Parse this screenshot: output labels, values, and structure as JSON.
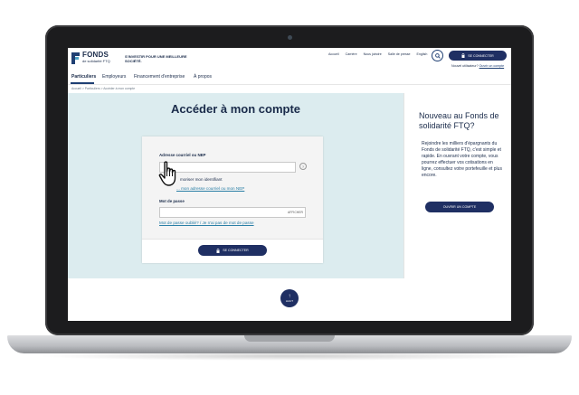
{
  "brand": {
    "name": "FONDS",
    "subtitle": "de solidarité FTQ",
    "tagline": "S'INVESTIR POUR UNE MEILLEURE SOCIÉTÉ."
  },
  "top_links": [
    "Accueil",
    "Carrière",
    "Nous joindre",
    "Salle de presse",
    "English"
  ],
  "header": {
    "login_label": "SE CONNECTER",
    "signup_question": "Nouvel utilisateur?",
    "signup_link": "Ouvrir un compte"
  },
  "nav": {
    "items": [
      "Particuliers",
      "Employeurs",
      "Financement d'entreprise",
      "À propos"
    ]
  },
  "breadcrumb": "Accueil  >  Particuliers  >  Accéder à mon compte",
  "page": {
    "title": "Accéder à mon compte"
  },
  "form": {
    "email_label": "Adresse courriel ou NEP",
    "email_value": "",
    "help_glyph": "?",
    "remember_label": "moriser mon identifiant",
    "forgot_email_link": "... mon adresse courriel ou mon NEP",
    "password_label": "Mot de passe",
    "password_value": "",
    "show_label": "AFFICHER",
    "forgot_password_link": "Mot de passe oublié? / Je n'ai pas de mot de passe",
    "submit_label": "SE CONNECTER"
  },
  "sidebar": {
    "title": "Nouveau au Fonds de solidarité FTQ?",
    "text": "Rejoindre les milliers d'épargnants du Fonds de solidarité FTQ, c'est simple et rapide. En ouvrant votre compte, vous pourrez effectuer vos cotisations en ligne, consultez votre portefeuille et plus encore.",
    "button_label": "OUVRIR UN COMPTE"
  },
  "back_to_top": {
    "label": "HAUT"
  },
  "colors": {
    "navy": "#1f2f63",
    "panel": "#dcecef",
    "link": "#2a7fa6"
  }
}
